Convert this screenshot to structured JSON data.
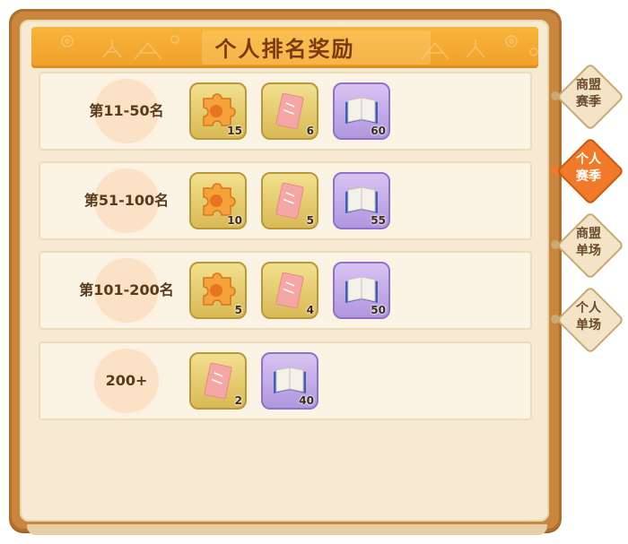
{
  "title": "个人排名奖励",
  "rows": [
    {
      "rank": "第11-50名",
      "items": [
        {
          "type": "puzzle",
          "qty": "15"
        },
        {
          "type": "ticket",
          "qty": "6"
        },
        {
          "type": "book",
          "qty": "60"
        }
      ]
    },
    {
      "rank": "第51-100名",
      "items": [
        {
          "type": "puzzle",
          "qty": "10"
        },
        {
          "type": "ticket",
          "qty": "5"
        },
        {
          "type": "book",
          "qty": "55"
        }
      ]
    },
    {
      "rank": "第101-200名",
      "items": [
        {
          "type": "puzzle",
          "qty": "5"
        },
        {
          "type": "ticket",
          "qty": "4"
        },
        {
          "type": "book",
          "qty": "50"
        }
      ]
    },
    {
      "rank": "200+",
      "items": [
        {
          "type": "ticket",
          "qty": "2"
        },
        {
          "type": "book",
          "qty": "40"
        }
      ]
    }
  ],
  "tabs": [
    {
      "line1": "商盟",
      "line2": "赛季",
      "active": false
    },
    {
      "line1": "个人",
      "line2": "赛季",
      "active": true
    },
    {
      "line1": "商盟",
      "line2": "单场",
      "active": false
    },
    {
      "line1": "个人",
      "line2": "单场",
      "active": false
    }
  ],
  "colors": {
    "frame": "#c9863f",
    "banner": "#f0a02a",
    "active_tab": "#f07a2a",
    "gold_item": "#d9b956",
    "purple_item": "#b096df"
  }
}
